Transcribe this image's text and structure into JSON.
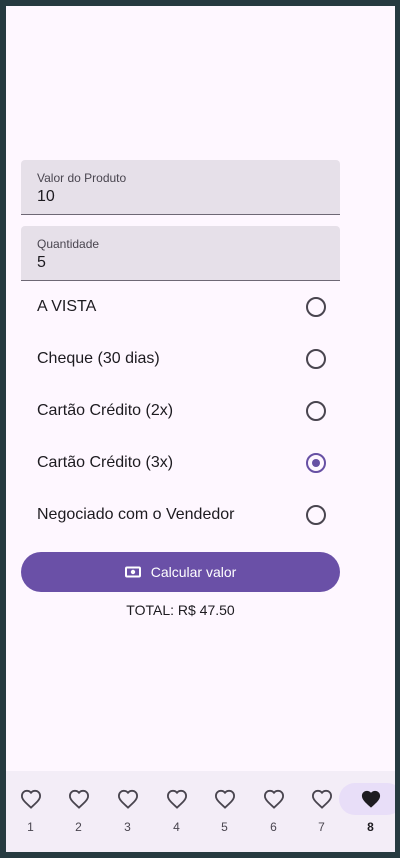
{
  "form": {
    "price": {
      "label": "Valor do Produto",
      "value": "10"
    },
    "quantity": {
      "label": "Quantidade",
      "value": "5"
    }
  },
  "payment_options": [
    {
      "label": "A VISTA",
      "selected": false
    },
    {
      "label": "Cheque (30 dias)",
      "selected": false
    },
    {
      "label": "Cartão Crédito (2x)",
      "selected": false
    },
    {
      "label": "Cartão Crédito (3x)",
      "selected": true
    },
    {
      "label": "Negociado com o Vendedor",
      "selected": false
    }
  ],
  "calculate_button": {
    "label": "Calcular valor",
    "icon": "money-icon"
  },
  "total_text": "TOTAL: R$ 47.50",
  "colors": {
    "accent": "#6a50a7",
    "field_bg": "#e6e0e9",
    "page_bg": "#fef7ff",
    "nav_bg": "#f3edf7",
    "nav_active": "#e8def8"
  },
  "nav": {
    "items": [
      {
        "label": "1",
        "icon": "heart-outline-icon",
        "active": false
      },
      {
        "label": "2",
        "icon": "heart-outline-icon",
        "active": false
      },
      {
        "label": "3",
        "icon": "heart-outline-icon",
        "active": false
      },
      {
        "label": "4",
        "icon": "heart-outline-icon",
        "active": false
      },
      {
        "label": "5",
        "icon": "heart-outline-icon",
        "active": false
      },
      {
        "label": "6",
        "icon": "heart-outline-icon",
        "active": false
      },
      {
        "label": "7",
        "icon": "heart-outline-icon",
        "active": false
      },
      {
        "label": "8",
        "icon": "heart-filled-icon",
        "active": true
      }
    ]
  }
}
